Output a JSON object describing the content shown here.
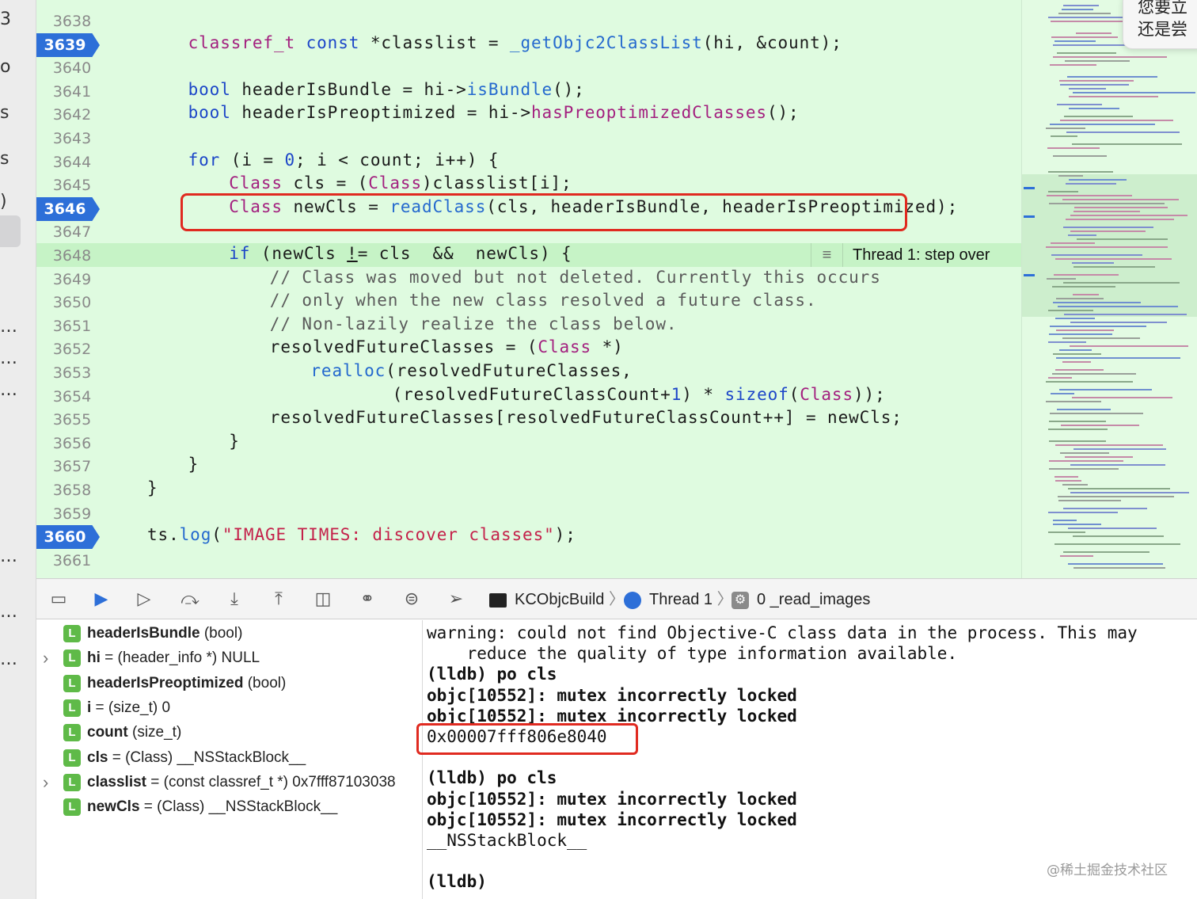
{
  "left_strip": {
    "chars": [
      "3",
      "o",
      "s",
      "s",
      ")",
      "…",
      "…",
      "…",
      "…",
      "…",
      "…"
    ]
  },
  "editor": {
    "lines": [
      {
        "num": "3638",
        "bp": false,
        "html": ""
      },
      {
        "num": "3639",
        "bp": true,
        "html": "<span class=\"ty\">classref_t</span> <span class=\"kw\">const</span> *classlist = <span class=\"fn\">_getObjc2ClassList</span>(hi, &amp;count);",
        "indent": 4
      },
      {
        "num": "3640",
        "bp": false,
        "html": ""
      },
      {
        "num": "3641",
        "bp": false,
        "html": "<span class=\"kw\">bool</span> headerIsBundle = hi-&gt;<span class=\"fn\">isBundle</span>();",
        "indent": 4
      },
      {
        "num": "3642",
        "bp": false,
        "html": "<span class=\"kw\">bool</span> headerIsPreoptimized = hi-&gt;<span class=\"ty\">hasPreoptimizedClasses</span>();",
        "indent": 4
      },
      {
        "num": "3643",
        "bp": false,
        "html": ""
      },
      {
        "num": "3644",
        "bp": false,
        "html": "<span class=\"kw\">for</span> (i = <span class=\"num\">0</span>; i &lt; count; i++) {",
        "indent": 4
      },
      {
        "num": "3645",
        "bp": false,
        "html": "<span class=\"ty\">Class</span> cls = (<span class=\"ty\">Class</span>)classlist[i];",
        "indent": 8
      },
      {
        "num": "3646",
        "bp": true,
        "html": "<span class=\"ty\">Class</span> newCls = <span class=\"fn\">readClass</span>(cls, headerIsBundle, headerIsPreoptimized);",
        "indent": 8
      },
      {
        "num": "3647",
        "bp": false,
        "html": ""
      },
      {
        "num": "3648",
        "bp": false,
        "html": "<span class=\"kw\">if</span> (newCls <u>!</u>= cls  &amp;&amp;  newCls) {",
        "indent": 8
      },
      {
        "num": "3649",
        "bp": false,
        "html": "<span class=\"cm\">// Class was moved but not deleted. Currently this occurs</span>",
        "indent": 12
      },
      {
        "num": "3650",
        "bp": false,
        "html": "<span class=\"cm\">// only when the new class resolved a future class.</span>",
        "indent": 12
      },
      {
        "num": "3651",
        "bp": false,
        "html": "<span class=\"cm\">// Non-lazily realize the class below.</span>",
        "indent": 12
      },
      {
        "num": "3652",
        "bp": false,
        "html": "resolvedFutureClasses = (<span class=\"ty\">Class</span> *)",
        "indent": 12
      },
      {
        "num": "3653",
        "bp": false,
        "html": "<span class=\"fn\">realloc</span>(resolvedFutureClasses,",
        "indent": 16
      },
      {
        "num": "3654",
        "bp": false,
        "html": "(resolvedFutureClassCount+<span class=\"num\">1</span>) * <span class=\"kw\">sizeof</span>(<span class=\"ty\">Class</span>));",
        "indent": 24
      },
      {
        "num": "3655",
        "bp": false,
        "html": "resolvedFutureClasses[resolvedFutureClassCount++] = newCls;",
        "indent": 12
      },
      {
        "num": "3656",
        "bp": false,
        "html": "}",
        "indent": 8
      },
      {
        "num": "3657",
        "bp": false,
        "html": "}",
        "indent": 4
      },
      {
        "num": "3658",
        "bp": false,
        "html": "}",
        "indent": 0
      },
      {
        "num": "3659",
        "bp": false,
        "html": ""
      },
      {
        "num": "3660",
        "bp": true,
        "html": "ts.<span class=\"fn\">log</span>(<span class=\"str\">\"IMAGE TIMES: discover classes\"</span>);",
        "indent": 0
      },
      {
        "num": "3661",
        "bp": false,
        "html": ""
      }
    ],
    "thread_annotation": "Thread 1: step over"
  },
  "debugbar": {
    "target": "KCObjcBuild",
    "thread": "Thread 1",
    "frame": "0 _read_images"
  },
  "variables": [
    {
      "expand": false,
      "name": "headerIsBundle",
      "rest": " (bool)"
    },
    {
      "expand": true,
      "name": "hi",
      "rest": " = (header_info *) NULL"
    },
    {
      "expand": false,
      "name": "headerIsPreoptimized",
      "rest": " (bool)"
    },
    {
      "expand": false,
      "name": "i",
      "rest": " = (size_t) 0"
    },
    {
      "expand": false,
      "name": "count",
      "rest": " (size_t)"
    },
    {
      "expand": false,
      "name": "cls",
      "rest": " = (Class) __NSStackBlock__"
    },
    {
      "expand": true,
      "name": "classlist",
      "rest": " = (const classref_t *) 0x7fff87103038"
    },
    {
      "expand": false,
      "name": "newCls",
      "rest": " = (Class) __NSStackBlock__"
    }
  ],
  "console": {
    "lines": [
      {
        "text": "warning: could not find Objective-C class data in the process. This may",
        "bold": false
      },
      {
        "text": "    reduce the quality of type information available.",
        "bold": false
      },
      {
        "text": "(lldb) po cls",
        "bold": true
      },
      {
        "text": "objc[10552]: mutex incorrectly locked",
        "bold": true
      },
      {
        "text": "objc[10552]: mutex incorrectly locked",
        "bold": true
      },
      {
        "text": "0x00007fff806e8040",
        "bold": false
      },
      {
        "text": "",
        "bold": false
      },
      {
        "text": "(lldb) po cls",
        "bold": true
      },
      {
        "text": "objc[10552]: mutex incorrectly locked",
        "bold": true
      },
      {
        "text": "objc[10552]: mutex incorrectly locked",
        "bold": true
      },
      {
        "text": "__NSStackBlock__",
        "bold": false
      },
      {
        "text": "",
        "bold": false
      },
      {
        "text": "(lldb)",
        "bold": true
      }
    ]
  },
  "watermark": "@稀土掘金技术社区",
  "popup": {
    "line1": "您要立",
    "line2": "还是尝"
  },
  "colors": {
    "editor_bg": "#dffbe0",
    "breakpoint": "#2d6fd8",
    "highlight_box": "#e02a20",
    "var_badge": "#5fba48"
  }
}
